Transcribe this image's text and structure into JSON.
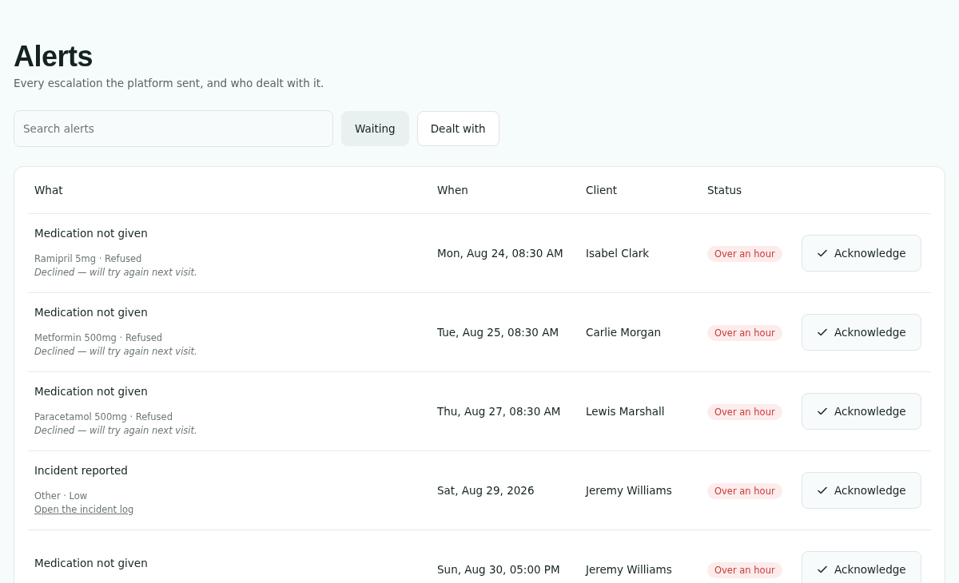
{
  "title": "Alerts",
  "subtitle": "Every escalation the platform sent, and who dealt with it.",
  "search": {
    "placeholder": "Search alerts"
  },
  "filters": [
    {
      "label": "Waiting",
      "selected": true
    },
    {
      "label": "Dealt with",
      "selected": false
    }
  ],
  "table": {
    "columns": [
      "What",
      "When",
      "Client",
      "Status"
    ],
    "rows": [
      {
        "what": "Medication not given",
        "meta": "Ramipril 5mg · Refused",
        "detail": {
          "kind": "note",
          "text": "Declined — will try again next visit."
        },
        "when": "Mon, Aug 24, 08:30 AM",
        "client": "Isabel Clark",
        "status": "Over an hour",
        "action": "Acknowledge"
      },
      {
        "what": "Medication not given",
        "meta": "Metformin 500mg · Refused",
        "detail": {
          "kind": "note",
          "text": "Declined — will try again next visit."
        },
        "when": "Tue, Aug 25, 08:30 AM",
        "client": "Carlie Morgan",
        "status": "Over an hour",
        "action": "Acknowledge"
      },
      {
        "what": "Medication not given",
        "meta": "Paracetamol 500mg · Refused",
        "detail": {
          "kind": "note",
          "text": "Declined — will try again next visit."
        },
        "when": "Thu, Aug 27, 08:30 AM",
        "client": "Lewis Marshall",
        "status": "Over an hour",
        "action": "Acknowledge"
      },
      {
        "what": "Incident reported",
        "meta": "Other · Low",
        "detail": {
          "kind": "link",
          "text": "Open the incident log"
        },
        "when": "Sat, Aug 29, 2026",
        "client": "Jeremy Williams",
        "status": "Over an hour",
        "action": "Acknowledge"
      },
      {
        "what": "Medication not given",
        "when": "Sun, Aug 30, 05:00 PM",
        "client": "Jeremy Williams",
        "status": "Over an hour",
        "action": "Acknowledge"
      }
    ]
  }
}
